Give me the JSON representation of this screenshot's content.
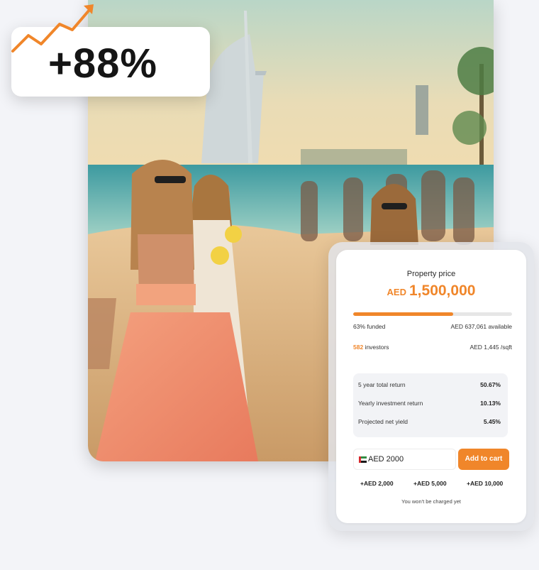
{
  "badge": {
    "growth": "+88%"
  },
  "property": {
    "price_label": "Property price",
    "currency": "AED",
    "price": "1,500,000",
    "funded_label": "63% funded",
    "funded_fraction": 0.63,
    "available": "AED 637,061 available",
    "investors_count": "582",
    "investors_label": " investors",
    "price_per_sqft": "AED 1,445 /sqft"
  },
  "returns": [
    {
      "label": "5 year total return",
      "value": "50.67%"
    },
    {
      "label": "Yearly investment return",
      "value": "10.13%"
    },
    {
      "label": "Projected net yield",
      "value": "5.45%"
    }
  ],
  "cart": {
    "amount": "AED 2000",
    "add_label": "Add to cart",
    "quick_amounts": [
      "+AED 2,000",
      "+AED 5,000",
      "+AED 10,000"
    ],
    "note": "You won't be charged yet"
  },
  "colors": {
    "accent": "#f0862a",
    "background": "#f3f4f8"
  },
  "icons": [
    "trend-up-arrow-icon",
    "uae-flag-icon"
  ]
}
